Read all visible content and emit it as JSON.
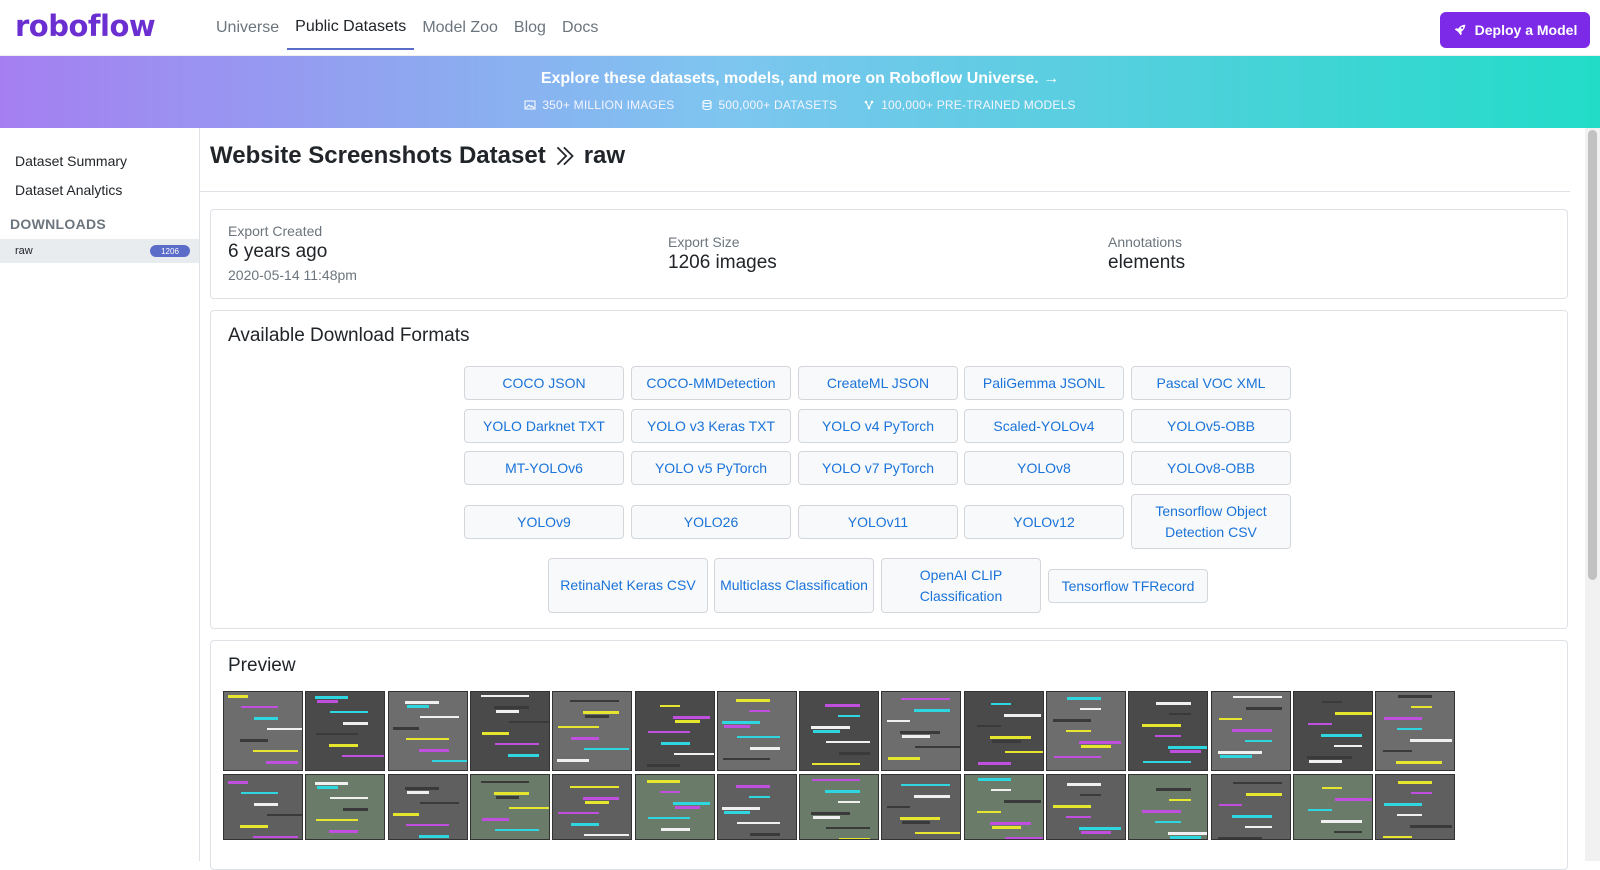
{
  "nav": {
    "logo": "roboflow",
    "links": [
      "Universe",
      "Public Datasets",
      "Model Zoo",
      "Blog",
      "Docs"
    ],
    "deploy_label": "Deploy a Model"
  },
  "banner": {
    "title": "Explore these datasets, models, and more on Roboflow Universe. →",
    "stats": [
      "350+ MILLION IMAGES",
      "500,000+ DATASETS",
      "100,000+ PRE-TRAINED MODELS"
    ]
  },
  "sidebar": {
    "links": [
      "Dataset Summary",
      "Dataset Analytics"
    ],
    "heading": "DOWNLOADS",
    "version": {
      "name": "raw",
      "count": "1206"
    }
  },
  "main": {
    "title": "Website Screenshots Dataset",
    "version": "raw",
    "export": {
      "created_label": "Export Created",
      "created_value": "6 years ago",
      "created_date": "2020-05-14 11:48pm",
      "size_label": "Export Size",
      "size_value": "1206 images",
      "annotations_label": "Annotations",
      "annotations_value": "elements"
    },
    "formats_title": "Available Download Formats",
    "formats": [
      "COCO JSON",
      "COCO-MMDetection",
      "CreateML JSON",
      "PaliGemma JSONL",
      "Pascal VOC XML",
      "YOLO Darknet TXT",
      "YOLO v3 Keras TXT",
      "YOLO v4 PyTorch",
      "Scaled-YOLOv4",
      "YOLOv5-OBB",
      "MT-YOLOv6",
      "YOLO v5 PyTorch",
      "YOLO v7 PyTorch",
      "YOLOv8",
      "YOLOv8-OBB",
      "YOLOv9",
      "YOLO26",
      "YOLOv11",
      "YOLOv12",
      "Tensorflow Object Detection CSV",
      "RetinaNet Keras CSV",
      "Multiclass Classification",
      "OpenAI CLIP Classification",
      "Tensorflow TFRecord"
    ],
    "preview_title": "Preview"
  },
  "colors": {
    "brand": "#6b2fd1",
    "deploy": "#7c2ae8",
    "link": "#1a73d9",
    "badge": "#5b6cc9"
  }
}
